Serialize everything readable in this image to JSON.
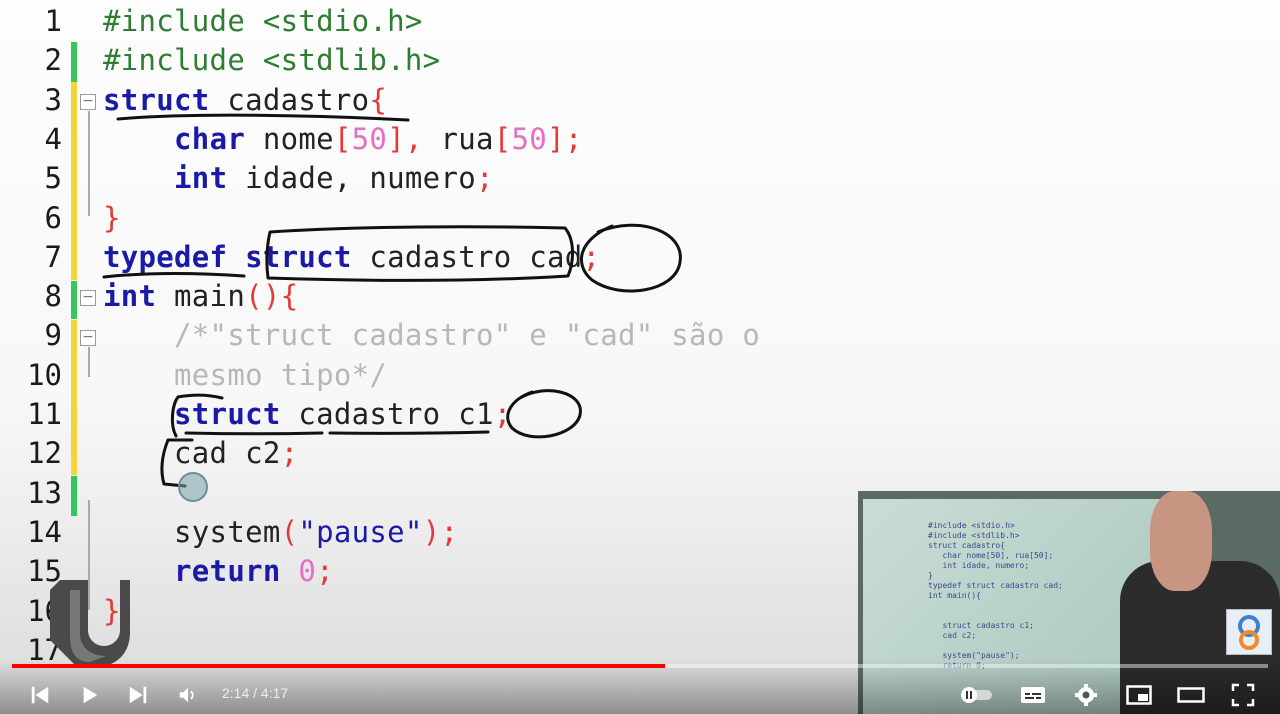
{
  "editor": {
    "line_numbers": [
      "1",
      "2",
      "3",
      "4",
      "5",
      "6",
      "7",
      "8",
      "9",
      "10",
      "11",
      "12",
      "13",
      "14",
      "15",
      "16",
      "17"
    ],
    "lines": [
      {
        "n": 1,
        "tokens": [
          {
            "t": "#include <stdio.h>",
            "c": "pp"
          }
        ]
      },
      {
        "n": 2,
        "tokens": [
          {
            "t": "#include <stdlib.h>",
            "c": "pp"
          }
        ]
      },
      {
        "n": 3,
        "tokens": [
          {
            "t": "struct",
            "c": "kw"
          },
          {
            "t": " cadastro",
            "c": "plain"
          },
          {
            "t": "{",
            "c": "red"
          }
        ]
      },
      {
        "n": 4,
        "tokens": [
          {
            "t": "    ",
            "c": "plain"
          },
          {
            "t": "char",
            "c": "kw"
          },
          {
            "t": " nome",
            "c": "plain"
          },
          {
            "t": "[",
            "c": "red"
          },
          {
            "t": "50",
            "c": "num"
          },
          {
            "t": "], ",
            "c": "red"
          },
          {
            "t": "rua",
            "c": "plain"
          },
          {
            "t": "[",
            "c": "red"
          },
          {
            "t": "50",
            "c": "num"
          },
          {
            "t": "];",
            "c": "red"
          }
        ]
      },
      {
        "n": 5,
        "tokens": [
          {
            "t": "    ",
            "c": "plain"
          },
          {
            "t": "int",
            "c": "kw"
          },
          {
            "t": " idade, numero",
            "c": "plain"
          },
          {
            "t": ";",
            "c": "red"
          }
        ]
      },
      {
        "n": 6,
        "tokens": [
          {
            "t": "}",
            "c": "red"
          }
        ]
      },
      {
        "n": 7,
        "tokens": [
          {
            "t": "typedef",
            "c": "kw"
          },
          {
            "t": " ",
            "c": "plain"
          },
          {
            "t": "struct",
            "c": "kw"
          },
          {
            "t": " cadastro cad",
            "c": "plain"
          },
          {
            "t": ";",
            "c": "red"
          }
        ]
      },
      {
        "n": 8,
        "tokens": [
          {
            "t": "int",
            "c": "kw"
          },
          {
            "t": " main",
            "c": "plain"
          },
          {
            "t": "(){",
            "c": "red"
          }
        ]
      },
      {
        "n": 9,
        "tokens": [
          {
            "t": "    /*\"struct cadastro\" e \"cad\" são o",
            "c": "cm"
          }
        ]
      },
      {
        "n": 10,
        "tokens": [
          {
            "t": "    mesmo tipo*/",
            "c": "cm"
          }
        ]
      },
      {
        "n": 11,
        "tokens": [
          {
            "t": "    ",
            "c": "plain"
          },
          {
            "t": "struct",
            "c": "kw"
          },
          {
            "t": " cadastro c1",
            "c": "plain"
          },
          {
            "t": ";",
            "c": "red"
          }
        ]
      },
      {
        "n": 12,
        "tokens": [
          {
            "t": "    cad c2",
            "c": "plain"
          },
          {
            "t": ";",
            "c": "red"
          }
        ]
      },
      {
        "n": 13,
        "tokens": []
      },
      {
        "n": 14,
        "tokens": [
          {
            "t": "    system",
            "c": "plain"
          },
          {
            "t": "(",
            "c": "red"
          },
          {
            "t": "\"pause\"",
            "c": "str"
          },
          {
            "t": ");",
            "c": "red"
          }
        ]
      },
      {
        "n": 15,
        "tokens": [
          {
            "t": "    ",
            "c": "plain"
          },
          {
            "t": "return",
            "c": "kw"
          },
          {
            "t": " ",
            "c": "plain"
          },
          {
            "t": "0",
            "c": "num"
          },
          {
            "t": ";",
            "c": "red"
          }
        ]
      },
      {
        "n": 16,
        "tokens": [
          {
            "t": "}",
            "c": "red"
          }
        ]
      },
      {
        "n": 17,
        "tokens": []
      }
    ]
  },
  "pip": {
    "mini_code": "#include <stdio.h>\n#include <stdlib.h>\nstruct cadastro{\n   char nome[50], rua[50];\n   int idade, numero;\n}\ntypedef struct cadastro cad;\nint main(){\n\n\n   struct cadastro c1;\n   cad c2;\n\n   system(\"pause\");\n   return 0;"
  },
  "player": {
    "current_time": "2:14",
    "duration": "4:17",
    "time_display": "2:14 / 4:17",
    "progress": 0.52,
    "accent_color": "#ff0000",
    "icons": [
      "previous-icon",
      "play-icon",
      "next-icon",
      "volume-icon",
      "autoplay-toggle-icon",
      "subtitles-icon",
      "settings-icon",
      "miniplayer-icon",
      "theater-icon",
      "fullscreen-icon"
    ]
  }
}
